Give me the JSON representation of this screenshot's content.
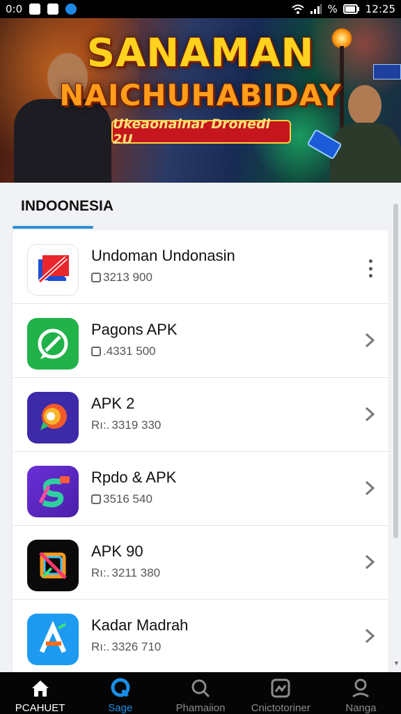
{
  "status_bar": {
    "time_left": "0:0",
    "right_text": "12:25",
    "percent": "%",
    "icons": [
      "notification-icon",
      "photo-icon",
      "app-icon",
      "wifi-icon",
      "signal-icon",
      "battery-icon"
    ]
  },
  "banner": {
    "title_line1": "SANAMAN",
    "title_line2": "NAICHUHABIDAY",
    "ribbon": "Ukeaonainar Dronedl 2U"
  },
  "section": {
    "title": "INDOONESIA",
    "accent": "#2f8fd8"
  },
  "apps": [
    {
      "name": "Undoman Undonasin",
      "meta_prefix": "",
      "meta": "3213 900",
      "action": "more-icon",
      "icon": "flag-app-icon"
    },
    {
      "name": "Pagons APK",
      "meta_prefix": "",
      "meta": ".4331 500",
      "action": "chevron-right-icon",
      "icon": "whatsapp-style-icon"
    },
    {
      "name": "APK 2",
      "meta_prefix": "Rı:.",
      "meta": "3319 330",
      "action": "chevron-right-icon",
      "icon": "chat-bubble-app-icon"
    },
    {
      "name": "Rpdo & APK",
      "meta_prefix": "",
      "meta": "3516 540",
      "action": "chevron-right-icon",
      "icon": "letter-s-app-icon"
    },
    {
      "name": "APK 90",
      "meta_prefix": "Rı:.",
      "meta": "3211 380",
      "action": "chevron-right-icon",
      "icon": "square-x-app-icon"
    },
    {
      "name": "Kadar Madrah",
      "meta_prefix": "Rı:.",
      "meta": "3326 710",
      "action": "chevron-right-icon",
      "icon": "letter-a-app-icon"
    }
  ],
  "bottom_nav": [
    {
      "label": "PCAHUET",
      "icon": "home-icon",
      "state": "active"
    },
    {
      "label": "Sage",
      "icon": "blue-q-icon",
      "state": "blue"
    },
    {
      "label": "Phamaiion",
      "icon": "search-icon",
      "state": "normal"
    },
    {
      "label": "Cnictotoriner",
      "icon": "photo-box-icon",
      "state": "normal"
    },
    {
      "label": "Nanga",
      "icon": "profile-icon",
      "state": "normal"
    }
  ]
}
